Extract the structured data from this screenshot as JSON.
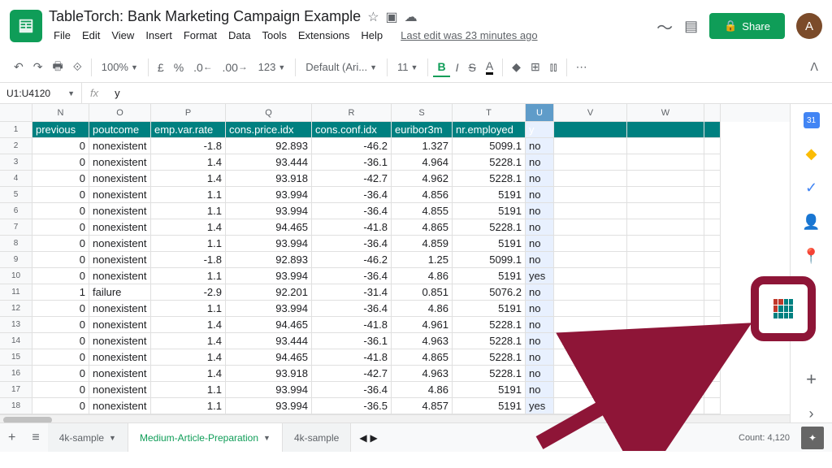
{
  "doc": {
    "title": "TableTorch: Bank Marketing Campaign Example",
    "last_edit": "Last edit was 23 minutes ago",
    "avatar": "A"
  },
  "menu": {
    "file": "File",
    "edit": "Edit",
    "view": "View",
    "insert": "Insert",
    "format": "Format",
    "data": "Data",
    "tools": "Tools",
    "extensions": "Extensions",
    "help": "Help"
  },
  "toolbar": {
    "zoom": "100%",
    "currency": "£",
    "percent": "%",
    "dec_dec": ".0",
    "inc_dec": ".00",
    "num_fmt": "123",
    "font": "Default (Ari...",
    "size": "11",
    "bold": "B",
    "italic": "I",
    "strike": "S",
    "underline_a": "A"
  },
  "share": {
    "label": "Share"
  },
  "formula": {
    "range": "U1:U4120",
    "fx": "fx",
    "value": "y"
  },
  "columns": [
    "N",
    "O",
    "P",
    "Q",
    "R",
    "S",
    "T",
    "U",
    "V",
    "W",
    ""
  ],
  "headers": [
    "previous",
    "poutcome",
    "emp.var.rate",
    "cons.price.idx",
    "cons.conf.idx",
    "euribor3m",
    "nr.employed",
    "y",
    "",
    "",
    ""
  ],
  "rows": [
    [
      "0",
      "nonexistent",
      "-1.8",
      "92.893",
      "-46.2",
      "1.327",
      "5099.1",
      "no"
    ],
    [
      "0",
      "nonexistent",
      "1.4",
      "93.444",
      "-36.1",
      "4.964",
      "5228.1",
      "no"
    ],
    [
      "0",
      "nonexistent",
      "1.4",
      "93.918",
      "-42.7",
      "4.962",
      "5228.1",
      "no"
    ],
    [
      "0",
      "nonexistent",
      "1.1",
      "93.994",
      "-36.4",
      "4.856",
      "5191",
      "no"
    ],
    [
      "0",
      "nonexistent",
      "1.1",
      "93.994",
      "-36.4",
      "4.855",
      "5191",
      "no"
    ],
    [
      "0",
      "nonexistent",
      "1.4",
      "94.465",
      "-41.8",
      "4.865",
      "5228.1",
      "no"
    ],
    [
      "0",
      "nonexistent",
      "1.1",
      "93.994",
      "-36.4",
      "4.859",
      "5191",
      "no"
    ],
    [
      "0",
      "nonexistent",
      "-1.8",
      "92.893",
      "-46.2",
      "1.25",
      "5099.1",
      "no"
    ],
    [
      "0",
      "nonexistent",
      "1.1",
      "93.994",
      "-36.4",
      "4.86",
      "5191",
      "yes"
    ],
    [
      "1",
      "failure",
      "-2.9",
      "92.201",
      "-31.4",
      "0.851",
      "5076.2",
      "no"
    ],
    [
      "0",
      "nonexistent",
      "1.1",
      "93.994",
      "-36.4",
      "4.86",
      "5191",
      "no"
    ],
    [
      "0",
      "nonexistent",
      "1.4",
      "94.465",
      "-41.8",
      "4.961",
      "5228.1",
      "no"
    ],
    [
      "0",
      "nonexistent",
      "1.4",
      "93.444",
      "-36.1",
      "4.963",
      "5228.1",
      "no"
    ],
    [
      "0",
      "nonexistent",
      "1.4",
      "94.465",
      "-41.8",
      "4.865",
      "5228.1",
      "no"
    ],
    [
      "0",
      "nonexistent",
      "1.4",
      "93.918",
      "-42.7",
      "4.963",
      "5228.1",
      "no"
    ],
    [
      "0",
      "nonexistent",
      "1.1",
      "93.994",
      "-36.4",
      "4.86",
      "5191",
      "no"
    ],
    [
      "0",
      "nonexistent",
      "1.1",
      "93.994",
      "-36.5",
      "4.857",
      "5191",
      "yes"
    ]
  ],
  "tabs": {
    "t1": "4k-sample",
    "t2": "Medium-Article-Preparation",
    "t3": "4k-sample"
  },
  "status": {
    "count": "Count: 4,120"
  }
}
